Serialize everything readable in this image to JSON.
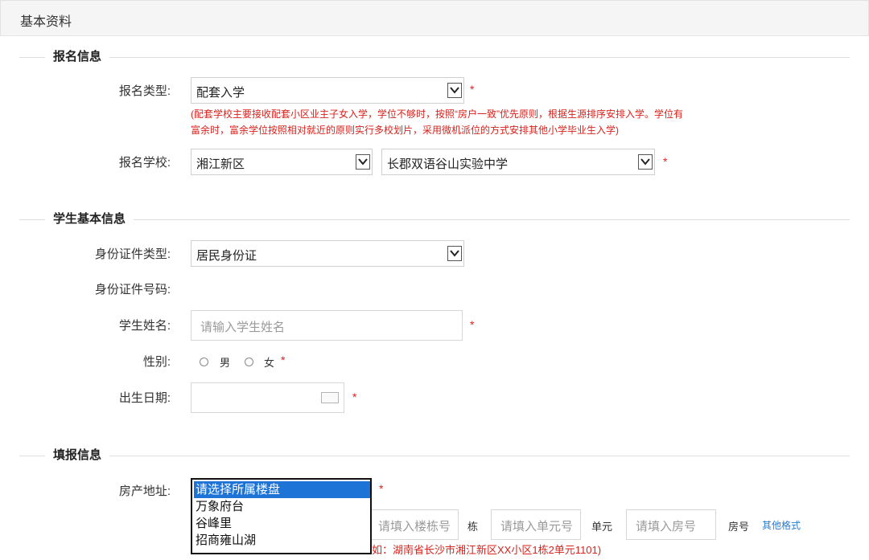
{
  "header": {
    "title": "基本资料"
  },
  "required_mark": "*",
  "sections": {
    "registration": {
      "title": "报名信息",
      "type_label": "报名类型:",
      "type_value": "配套入学",
      "note_line1": "(配套学校主要接收配套小区业主子女入学，学位不够时，按照“房户一致”优先原则，根据生源排序安排入学。学位有",
      "note_line2": "富余时，富余学位按照相对就近的原则实行多校划片，采用微机派位的方式安排其他小学毕业生入学)",
      "school_label": "报名学校:",
      "district_value": "湘江新区",
      "school_value": "长郡双语谷山实验中学"
    },
    "student": {
      "title": "学生基本信息",
      "id_type_label": "身份证件类型:",
      "id_type_value": "居民身份证",
      "id_number_label": "身份证件号码:",
      "name_label": "学生姓名:",
      "name_placeholder": "请输入学生姓名",
      "gender_label": "性别:",
      "gender_male": "男",
      "gender_female": "女",
      "birth_label": "出生日期:"
    },
    "fill": {
      "title": "填报信息",
      "address_label": "房产地址:",
      "address_options": [
        "请选择所属楼盘",
        "万象府台",
        "谷峰里",
        "招商雍山湖"
      ],
      "building_placeholder": "请填入楼栋号",
      "building_unit": "栋",
      "unit_placeholder": "请填入单元号",
      "unit_unit": "单元",
      "room_placeholder": "请填入房号",
      "room_unit": "房号",
      "other_format_link": "其他格式",
      "example_text": "如：湖南省长沙市湘江新区XX小区1栋2单元1101)"
    }
  }
}
